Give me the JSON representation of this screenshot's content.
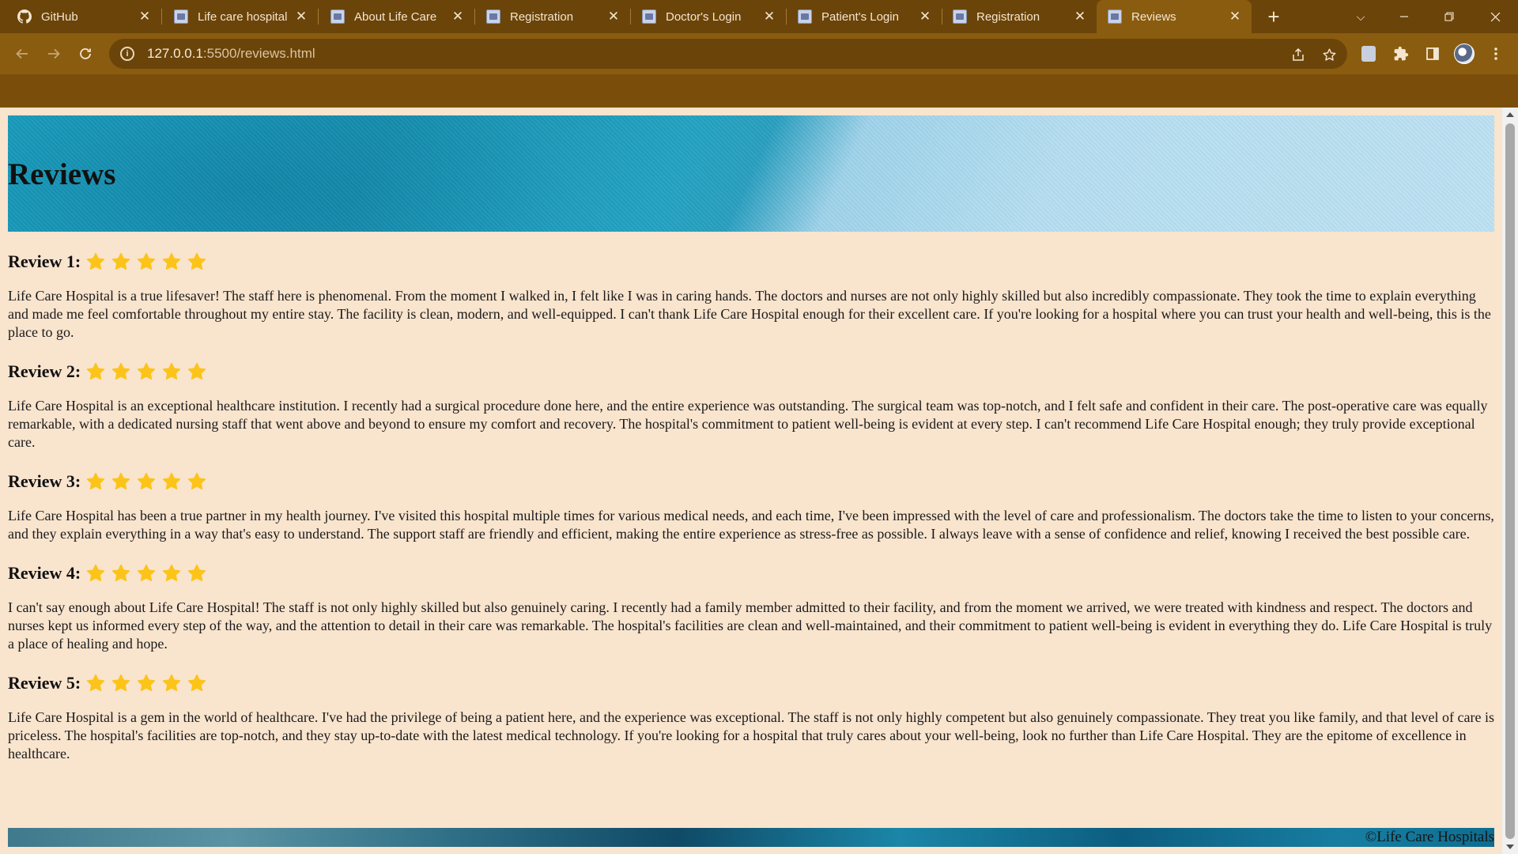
{
  "browser": {
    "tabs": [
      {
        "title": "GitHub",
        "icon": "github-icon"
      },
      {
        "title": "Life care hospital",
        "icon": "site-favicon-icon"
      },
      {
        "title": "About Life Care",
        "icon": "site-favicon-icon"
      },
      {
        "title": "Registration",
        "icon": "site-favicon-icon"
      },
      {
        "title": "Doctor's Login",
        "icon": "site-favicon-icon"
      },
      {
        "title": "Patient's Login",
        "icon": "site-favicon-icon"
      },
      {
        "title": "Registration",
        "icon": "site-favicon-icon"
      },
      {
        "title": "Reviews",
        "icon": "site-favicon-icon",
        "active": true
      }
    ],
    "address": {
      "host": "127.0.0.1",
      "path": ":5500/reviews.html"
    },
    "colors": {
      "frame": "#6b4409",
      "toolbar": "#8a5c10",
      "bookmarks_bar": "#7a4e0a"
    }
  },
  "page": {
    "title": "Reviews",
    "star_color": "#fcc419",
    "reviews": [
      {
        "heading": "Review 1:",
        "rating": 5,
        "text": "Life Care Hospital is a true lifesaver! The staff here is phenomenal. From the moment I walked in, I felt like I was in caring hands. The doctors and nurses are not only highly skilled but also incredibly compassionate. They took the time to explain everything and made me feel comfortable throughout my entire stay. The facility is clean, modern, and well-equipped. I can't thank Life Care Hospital enough for their excellent care. If you're looking for a hospital where you can trust your health and well-being, this is the place to go."
      },
      {
        "heading": "Review 2:",
        "rating": 5,
        "text": "Life Care Hospital is an exceptional healthcare institution. I recently had a surgical procedure done here, and the entire experience was outstanding. The surgical team was top-notch, and I felt safe and confident in their care. The post-operative care was equally remarkable, with a dedicated nursing staff that went above and beyond to ensure my comfort and recovery. The hospital's commitment to patient well-being is evident at every step. I can't recommend Life Care Hospital enough; they truly provide exceptional care."
      },
      {
        "heading": "Review 3:",
        "rating": 5,
        "text": "Life Care Hospital has been a true partner in my health journey. I've visited this hospital multiple times for various medical needs, and each time, I've been impressed with the level of care and professionalism. The doctors take the time to listen to your concerns, and they explain everything in a way that's easy to understand. The support staff are friendly and efficient, making the entire experience as stress-free as possible. I always leave with a sense of confidence and relief, knowing I received the best possible care."
      },
      {
        "heading": "Review 4:",
        "rating": 5,
        "text": "I can't say enough about Life Care Hospital! The staff is not only highly skilled but also genuinely caring. I recently had a family member admitted to their facility, and from the moment we arrived, we were treated with kindness and respect. The doctors and nurses kept us informed every step of the way, and the attention to detail in their care was remarkable. The hospital's facilities are clean and well-maintained, and their commitment to patient well-being is evident in everything they do. Life Care Hospital is truly a place of healing and hope."
      },
      {
        "heading": "Review 5:",
        "rating": 5,
        "text": "Life Care Hospital is a gem in the world of healthcare. I've had the privilege of being a patient here, and the experience was exceptional. The staff is not only highly competent but also genuinely compassionate. They treat you like family, and that level of care is priceless. The hospital's facilities are top-notch, and they stay up-to-date with the latest medical technology. If you're looking for a hospital that truly cares about your well-being, look no further than Life Care Hospital. They are the epitome of excellence in healthcare."
      }
    ],
    "footer": "©Life Care Hospitals"
  }
}
